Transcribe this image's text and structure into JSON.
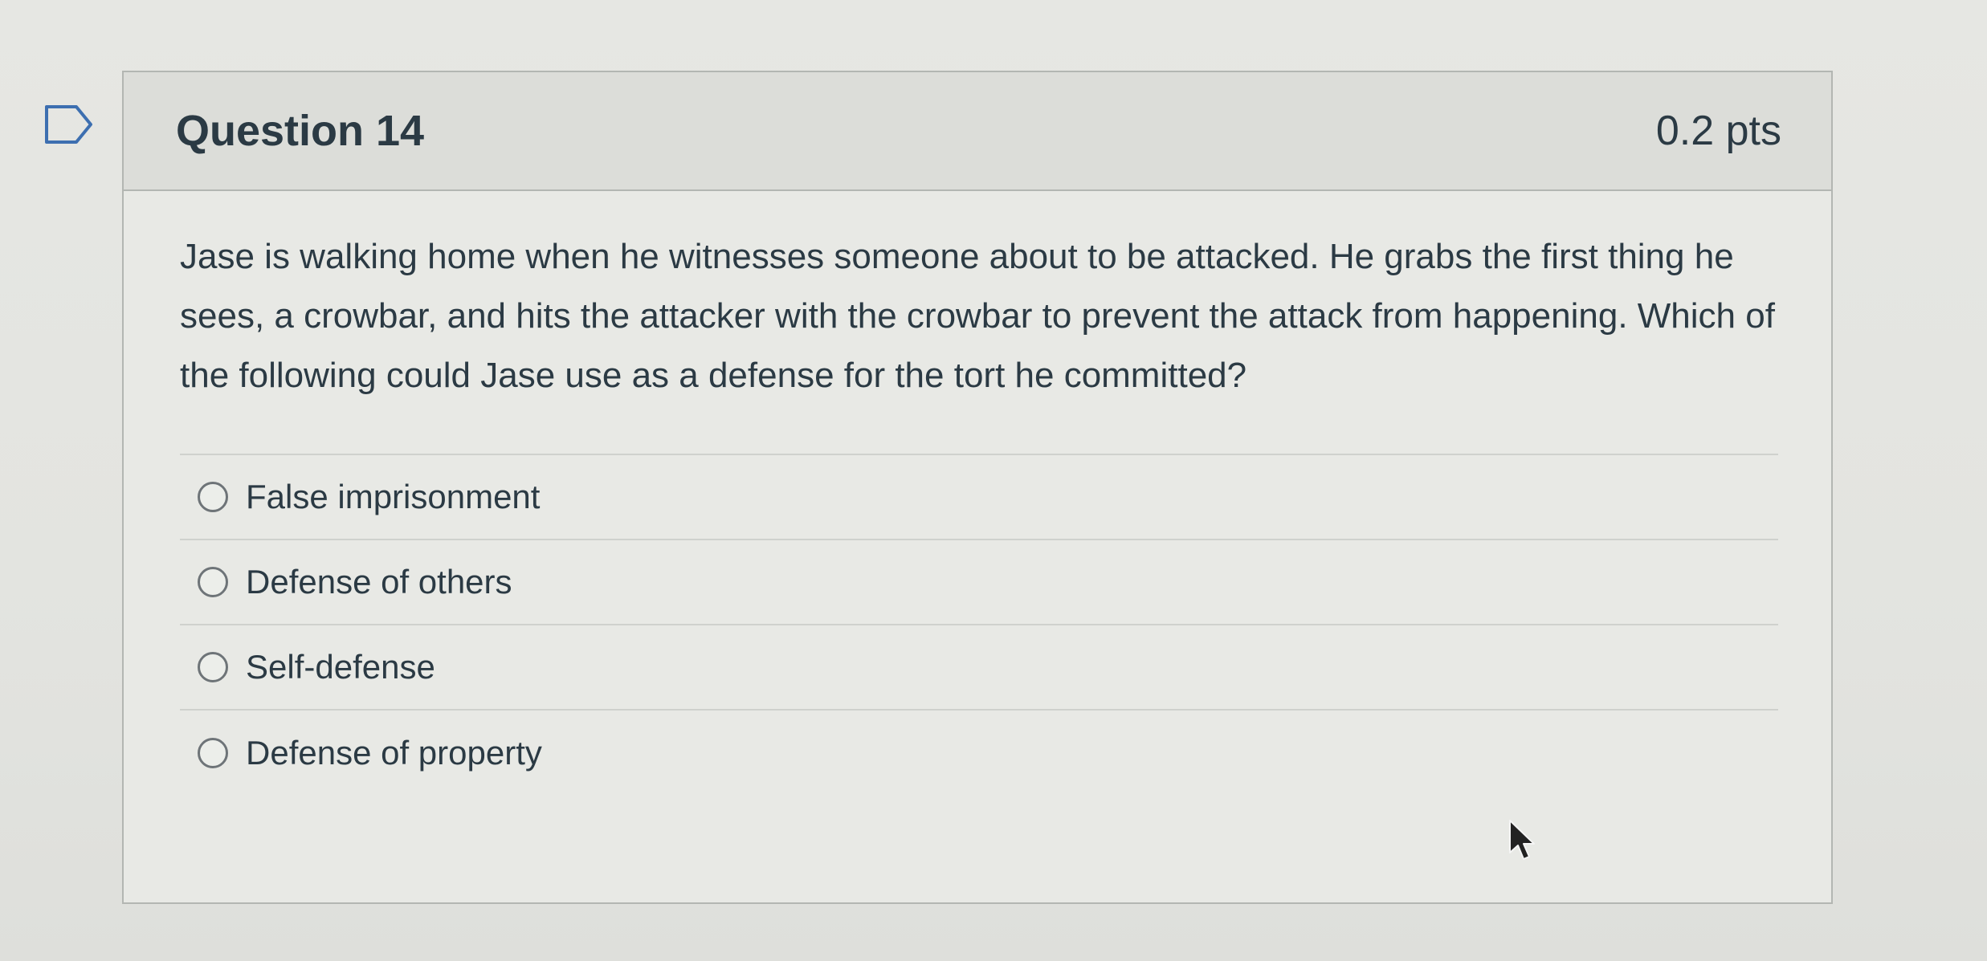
{
  "question": {
    "title": "Question 14",
    "points": "0.2 pts",
    "text": "Jase is walking home when he witnesses someone about to be attacked. He grabs the first thing he sees, a crowbar, and hits the attacker with the crowbar to prevent the attack from happening. Which of the following could Jase use as a defense for the tort he committed?",
    "answers": [
      {
        "label": "False imprisonment",
        "selected": false
      },
      {
        "label": "Defense of others",
        "selected": false
      },
      {
        "label": "Self-defense",
        "selected": false
      },
      {
        "label": "Defense of property",
        "selected": false
      }
    ]
  },
  "icons": {
    "flag": "flag-question-icon",
    "radio": "radio-unchecked-icon",
    "cursor": "mouse-pointer-icon"
  },
  "colors": {
    "text": "#2b3a44",
    "header_bg": "#dcddd9",
    "border": "#b3b6b2"
  }
}
